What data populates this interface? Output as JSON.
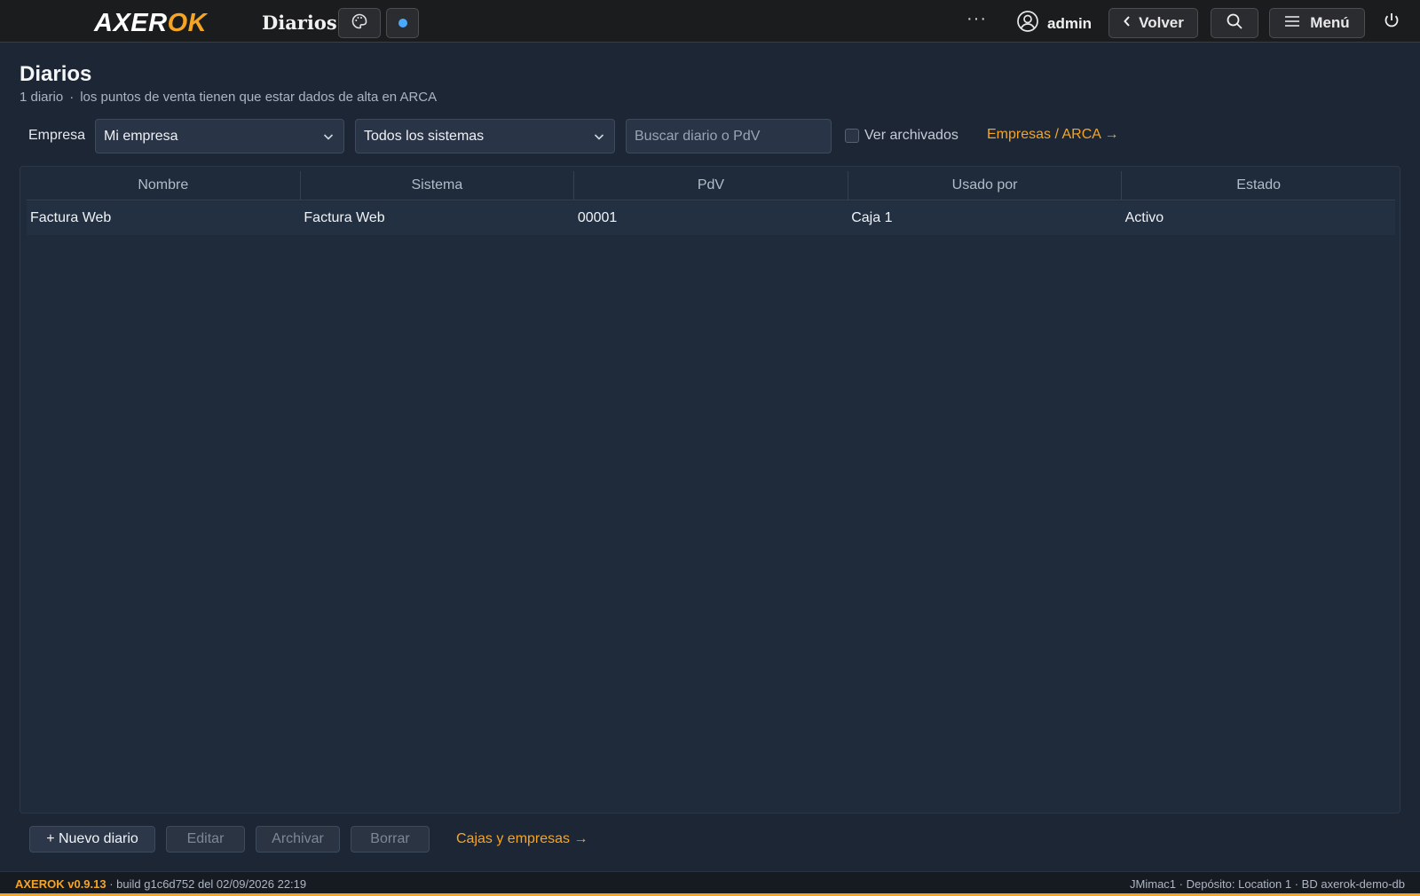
{
  "topbar": {
    "logo_part1": "AXER",
    "logo_part2": "OK",
    "app_title": "Diarios",
    "ellipsis": "···",
    "user_name": "admin",
    "back_label": "Volver",
    "menu_label": "Menú"
  },
  "header": {
    "title": "Diarios",
    "count": "1 diario",
    "separator": "·",
    "note": "los puntos de venta tienen que estar dados de alta en ARCA"
  },
  "filters": {
    "empresa_label": "Empresa",
    "empresa_value": "Mi empresa",
    "sistema_value": "Todos los sistemas",
    "search_placeholder": "Buscar diario o PdV",
    "archived_label": "Ver archivados",
    "empresas_link": "Empresas / ARCA →"
  },
  "table": {
    "columns": [
      "Nombre",
      "Sistema",
      "PdV",
      "Usado por",
      "Estado"
    ],
    "rows": [
      [
        "Factura Web",
        "Factura Web",
        "00001",
        "Caja 1",
        "Activo"
      ]
    ]
  },
  "actions": {
    "new_label": "+ Nuevo diario",
    "edit_label": "Editar",
    "archive_label": "Archivar",
    "delete_label": "Borrar",
    "cajas_link": "Cajas y empresas →"
  },
  "footer": {
    "version": "AXEROK v0.9.13",
    "build": " · build g1c6d752 del 02/09/2026 22:19",
    "right": "JMimac1 · Depósito: Location 1 · BD axerok-demo-db"
  },
  "colors": {
    "accent": "#f5a524",
    "background": "#1d2635",
    "topbar": "#1b1c1e"
  },
  "icons": [
    "palette-icon",
    "status-dot-icon",
    "user-circle-icon",
    "chevron-left-icon",
    "search-icon",
    "hamburger-icon",
    "power-icon",
    "chevron-down-icon"
  ]
}
